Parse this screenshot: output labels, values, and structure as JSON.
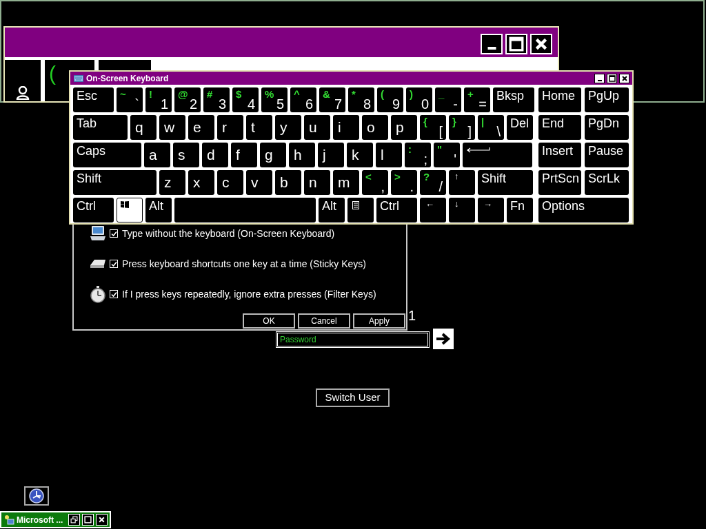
{
  "back_window": {
    "controls": [
      {
        "kind": "minimize"
      },
      {
        "kind": "maximize"
      },
      {
        "kind": "close"
      }
    ],
    "key_label": "("
  },
  "keyboard": {
    "title": "On-Screen Keyboard",
    "controls": [
      {
        "kind": "minimize"
      },
      {
        "kind": "maximize"
      },
      {
        "kind": "close"
      }
    ],
    "rows": [
      {
        "main": [
          {
            "kind": "text",
            "label": "Esc",
            "pressed": false
          },
          {
            "kind": "symbol",
            "shift": "~",
            "label": "`",
            "pressed": false
          },
          {
            "kind": "symbol",
            "shift": "!",
            "label": "1",
            "pressed": false
          },
          {
            "kind": "symbol",
            "shift": "@",
            "label": "2",
            "pressed": false
          },
          {
            "kind": "symbol",
            "shift": "#",
            "label": "3",
            "pressed": false
          },
          {
            "kind": "symbol",
            "shift": "$",
            "label": "4",
            "pressed": false
          },
          {
            "kind": "symbol",
            "shift": "%",
            "label": "5",
            "pressed": false
          },
          {
            "kind": "symbol",
            "shift": "^",
            "label": "6",
            "pressed": false
          },
          {
            "kind": "symbol",
            "shift": "&",
            "label": "7",
            "pressed": false
          },
          {
            "kind": "symbol",
            "shift": "*",
            "label": "8",
            "pressed": false
          },
          {
            "kind": "symbol",
            "shift": "(",
            "label": "9",
            "pressed": false
          },
          {
            "kind": "symbol",
            "shift": ")",
            "label": "0",
            "pressed": false
          },
          {
            "kind": "symbol",
            "shift": "_",
            "label": "-",
            "pressed": false
          },
          {
            "kind": "symbol",
            "shift": "+",
            "label": "=",
            "pressed": false
          },
          {
            "kind": "text",
            "label": "Bksp",
            "pressed": false
          }
        ],
        "nav": [
          {
            "kind": "text",
            "label": "Home",
            "pressed": false
          },
          {
            "kind": "text",
            "label": "PgUp",
            "pressed": false
          }
        ]
      },
      {
        "main": [
          {
            "kind": "text",
            "label": "Tab",
            "pressed": false
          },
          {
            "kind": "letter",
            "label": "q",
            "pressed": false
          },
          {
            "kind": "letter",
            "label": "w",
            "pressed": false
          },
          {
            "kind": "letter",
            "label": "e",
            "pressed": false
          },
          {
            "kind": "letter",
            "label": "r",
            "pressed": false
          },
          {
            "kind": "letter",
            "label": "t",
            "pressed": false
          },
          {
            "kind": "letter",
            "label": "y",
            "pressed": false
          },
          {
            "kind": "letter",
            "label": "u",
            "pressed": false
          },
          {
            "kind": "letter",
            "label": "i",
            "pressed": false
          },
          {
            "kind": "letter",
            "label": "o",
            "pressed": false
          },
          {
            "kind": "letter",
            "label": "p",
            "pressed": false
          },
          {
            "kind": "symbol",
            "shift": "{",
            "label": "[",
            "pressed": false
          },
          {
            "kind": "symbol",
            "shift": "}",
            "label": "]",
            "pressed": false
          },
          {
            "kind": "symbol",
            "shift": "|",
            "label": "\\",
            "pressed": false
          },
          {
            "kind": "text",
            "label": "Del",
            "pressed": false
          }
        ],
        "nav": [
          {
            "kind": "text",
            "label": "End",
            "pressed": false
          },
          {
            "kind": "text",
            "label": "PgDn",
            "pressed": false
          }
        ]
      },
      {
        "main": [
          {
            "kind": "text",
            "label": "Caps",
            "pressed": false
          },
          {
            "kind": "letter",
            "label": "a",
            "pressed": false
          },
          {
            "kind": "letter",
            "label": "s",
            "pressed": false
          },
          {
            "kind": "letter",
            "label": "d",
            "pressed": false
          },
          {
            "kind": "letter",
            "label": "f",
            "pressed": false
          },
          {
            "kind": "letter",
            "label": "g",
            "pressed": false
          },
          {
            "kind": "letter",
            "label": "h",
            "pressed": false
          },
          {
            "kind": "letter",
            "label": "j",
            "pressed": false
          },
          {
            "kind": "letter",
            "label": "k",
            "pressed": false
          },
          {
            "kind": "letter",
            "label": "l",
            "pressed": false
          },
          {
            "kind": "symbol",
            "shift": ":",
            "label": ";",
            "pressed": false
          },
          {
            "kind": "symbol",
            "shift": "\"",
            "label": "'",
            "pressed": false
          },
          {
            "kind": "enter",
            "pressed": false
          }
        ],
        "nav": [
          {
            "kind": "text",
            "label": "Insert",
            "pressed": false
          },
          {
            "kind": "text",
            "label": "Pause",
            "pressed": false
          }
        ]
      },
      {
        "main": [
          {
            "kind": "text",
            "label": "Shift",
            "pressed": false
          },
          {
            "kind": "letter",
            "label": "z",
            "pressed": false
          },
          {
            "kind": "letter",
            "label": "x",
            "pressed": false
          },
          {
            "kind": "letter",
            "label": "c",
            "pressed": false
          },
          {
            "kind": "letter",
            "label": "v",
            "pressed": false
          },
          {
            "kind": "letter",
            "label": "b",
            "pressed": false
          },
          {
            "kind": "letter",
            "label": "n",
            "pressed": false
          },
          {
            "kind": "letter",
            "label": "m",
            "pressed": false
          },
          {
            "kind": "symbol",
            "shift": "<",
            "label": ",",
            "pressed": false
          },
          {
            "kind": "symbol",
            "shift": ">",
            "label": ".",
            "pressed": false
          },
          {
            "kind": "symbol",
            "shift": "?",
            "label": "/",
            "pressed": false
          },
          {
            "kind": "arrow",
            "label": "↑",
            "pressed": false
          },
          {
            "kind": "text",
            "label": "Shift",
            "pressed": false
          }
        ],
        "nav": [
          {
            "kind": "text",
            "label": "PrtScn",
            "pressed": false
          },
          {
            "kind": "text",
            "label": "ScrLk",
            "pressed": false
          }
        ]
      },
      {
        "main": [
          {
            "kind": "text",
            "label": "Ctrl",
            "pressed": false
          },
          {
            "kind": "logo",
            "pressed": true
          },
          {
            "kind": "text",
            "label": "Alt",
            "pressed": false
          },
          {
            "kind": "space",
            "pressed": false
          },
          {
            "kind": "text",
            "label": "Alt",
            "pressed": false
          },
          {
            "kind": "menu",
            "pressed": false
          },
          {
            "kind": "text",
            "label": "Ctrl",
            "pressed": false
          },
          {
            "kind": "arrow",
            "label": "←",
            "pressed": false
          },
          {
            "kind": "arrow",
            "label": "↓",
            "pressed": false
          },
          {
            "kind": "arrow",
            "label": "→",
            "pressed": false
          },
          {
            "kind": "text",
            "label": "Fn",
            "pressed": false
          }
        ],
        "nav": [
          {
            "kind": "text",
            "label": "Options",
            "pressed": false
          }
        ]
      }
    ]
  },
  "dialog": {
    "options": [
      {
        "kind": "keyboard",
        "label": "Type without the keyboard (On-Screen Keyboard)",
        "checked": true
      },
      {
        "kind": "key",
        "label": "Press keyboard shortcuts one key at a time (Sticky Keys)",
        "checked": true
      },
      {
        "kind": "stopwatch",
        "label": "If I press keys repeatedly, ignore extra presses (Filter Keys)",
        "checked": true
      }
    ],
    "buttons": [
      "OK",
      "Cancel",
      "Apply"
    ]
  },
  "count": "1",
  "password": {
    "placeholder": "Password"
  },
  "switch_user": "Switch User",
  "taskbar": {
    "title": "Microsoft ...",
    "controls": [
      {
        "kind": "restore"
      },
      {
        "kind": "maximize"
      },
      {
        "kind": "close"
      }
    ]
  }
}
